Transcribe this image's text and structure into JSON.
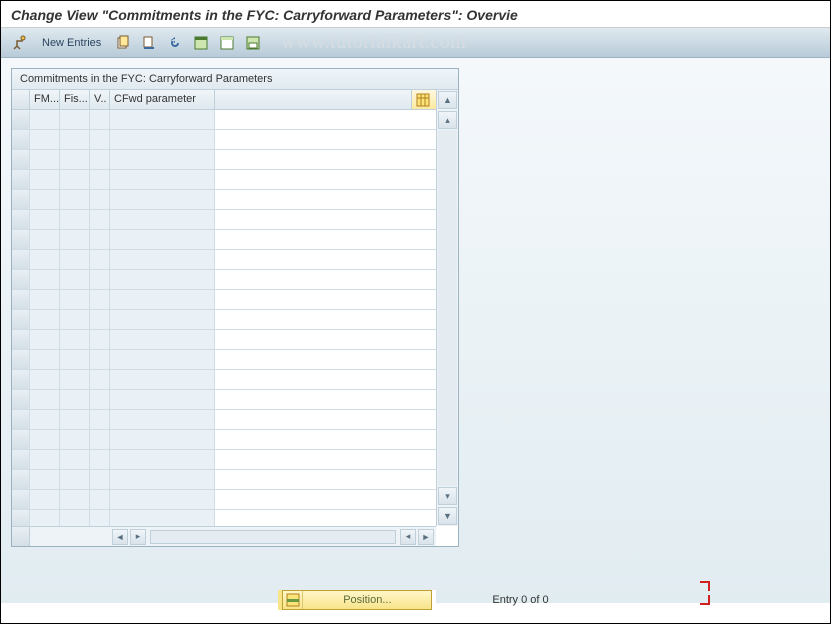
{
  "title": "Change View \"Commitments in the FYC: Carryforward Parameters\": Overvie",
  "toolbar": {
    "new_entries": "New Entries"
  },
  "watermark": "www.tutorialkart.com",
  "panel": {
    "title": "Commitments in the FYC: Carryforward Parameters",
    "columns": {
      "c1": "FM...",
      "c2": "Fis...",
      "c3": "V..",
      "c4": "CFwd parameter"
    }
  },
  "rowCount": 21,
  "footer": {
    "position_label": "Position...",
    "entry_text": "Entry 0 of 0"
  }
}
